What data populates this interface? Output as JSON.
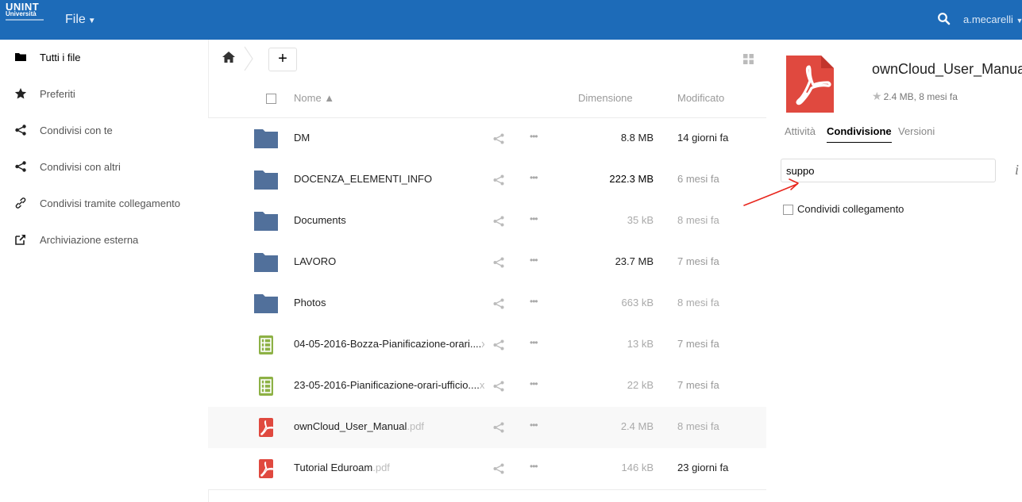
{
  "header": {
    "logo_line1": "UNINT",
    "logo_line2": "Università",
    "app_menu_label": "File",
    "user_name": "a.mecarelli"
  },
  "sidebar": {
    "items": [
      {
        "label": "Tutti i file",
        "icon": "folder-icon"
      },
      {
        "label": "Preferiti",
        "icon": "star-icon"
      },
      {
        "label": "Condivisi con te",
        "icon": "share-icon"
      },
      {
        "label": "Condivisi con altri",
        "icon": "share-icon"
      },
      {
        "label": "Condivisi tramite collegamento",
        "icon": "link-icon"
      },
      {
        "label": "Archiviazione esterna",
        "icon": "external-storage-icon"
      }
    ]
  },
  "filelist": {
    "new_label": "+",
    "columns": {
      "name": "Nome ▲",
      "size": "Dimensione",
      "modified": "Modificato"
    },
    "rows": [
      {
        "type": "folder",
        "name": "DM",
        "ext": "",
        "size": "8.8 MB",
        "modified": "14 giorni fa",
        "size_color": "#222222",
        "mod_color": "#222222"
      },
      {
        "type": "folder",
        "name": "DOCENZA_ELEMENTI_INFO",
        "ext": "",
        "size": "222.3 MB",
        "modified": "6 mesi fa",
        "size_color": "#000000",
        "mod_color": "#999999"
      },
      {
        "type": "folder",
        "name": "Documents",
        "ext": "",
        "size": "35 kB",
        "modified": "8 mesi fa",
        "size_color": "#aaaaaa",
        "mod_color": "#aaaaaa"
      },
      {
        "type": "folder",
        "name": "LAVORO",
        "ext": "",
        "size": "23.7 MB",
        "modified": "7 mesi fa",
        "size_color": "#222222",
        "mod_color": "#999999"
      },
      {
        "type": "folder",
        "name": "Photos",
        "ext": "",
        "size": "663 kB",
        "modified": "8 mesi fa",
        "size_color": "#aaaaaa",
        "mod_color": "#aaaaaa"
      },
      {
        "type": "spreadsheet",
        "name": "04-05-2016-Bozza-Pianificazione-orari....",
        "ext": "xls",
        "size": "13 kB",
        "modified": "7 mesi fa",
        "size_color": "#aaaaaa",
        "mod_color": "#999999"
      },
      {
        "type": "spreadsheet",
        "name": "23-05-2016-Pianificazione-orari-ufficio....",
        "ext": "xls",
        "size": "22 kB",
        "modified": "7 mesi fa",
        "size_color": "#aaaaaa",
        "mod_color": "#999999"
      },
      {
        "type": "pdf",
        "name": "ownCloud_User_Manual",
        "ext": ".pdf",
        "size": "2.4 MB",
        "modified": "8 mesi fa",
        "size_color": "#aaaaaa",
        "mod_color": "#aaaaaa",
        "selected": true
      },
      {
        "type": "pdf",
        "name": "Tutorial Eduroam",
        "ext": ".pdf",
        "size": "146 kB",
        "modified": "23 giorni fa",
        "size_color": "#aaaaaa",
        "mod_color": "#222222"
      }
    ]
  },
  "details": {
    "title": "ownCloud_User_Manual.pdf",
    "meta": "2.4 MB, 8 mesi fa",
    "tabs": [
      "Attività",
      "Condivisione",
      "Versioni"
    ],
    "active_tab": 1,
    "share_input_value": "suppo",
    "info_label": "i",
    "link_share_label": "Condividi collegamento"
  },
  "colors": {
    "header": "#1d6bb8",
    "folder": "#51709b",
    "spreadsheet": "#8db145",
    "pdf": "#e0493f",
    "annotation": "#e8261d"
  }
}
